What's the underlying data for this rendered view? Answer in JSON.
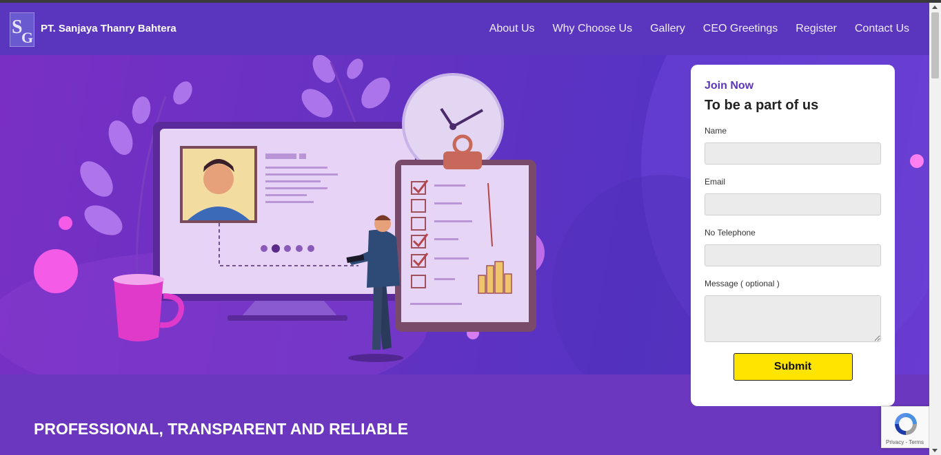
{
  "brand": {
    "name": "PT. Sanjaya Thanry Bahtera",
    "logo_icon": "company-logo-icon"
  },
  "nav": {
    "items": [
      "About Us",
      "Why Choose Us",
      "Gallery",
      "CEO Greetings",
      "Register",
      "Contact Us"
    ]
  },
  "form": {
    "kicker": "Join Now",
    "title": "To be a part of us",
    "fields": {
      "name_label": "Name",
      "email_label": "Email",
      "phone_label": "No Telephone",
      "message_label": "Message ( optional )"
    },
    "submit_label": "Submit"
  },
  "recaptcha": {
    "text": "Privacy - Terms",
    "icon": "recaptcha-icon"
  },
  "tagline": "PROFESSIONAL, TRANSPARENT AND RELIABLE",
  "colors": {
    "accent": "#5a35b8",
    "submit": "#ffe400",
    "hero": "#6532c2"
  }
}
